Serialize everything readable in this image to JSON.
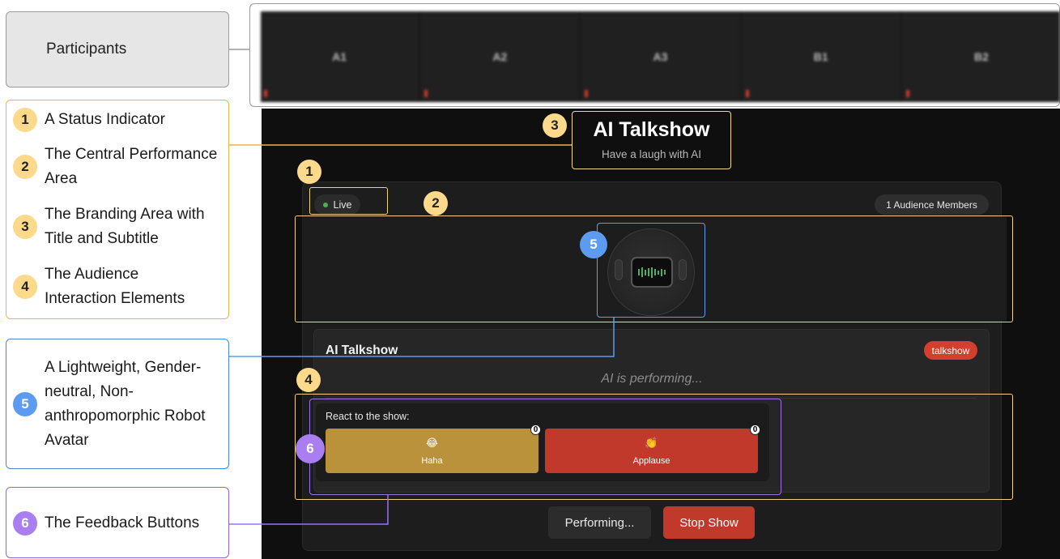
{
  "legend": {
    "participants_label": "Participants",
    "yellow_items": [
      {
        "num": "1",
        "text": "A Status Indicator"
      },
      {
        "num": "2",
        "text": "The Central Performance Area"
      },
      {
        "num": "3",
        "text": "The Branding Area with Title and Subtitle"
      },
      {
        "num": "4",
        "text": "The Audience Interaction Elements"
      }
    ],
    "blue_item": {
      "num": "5",
      "text": "A Lightweight, Gender-neutral, Non-anthropomorphic Robot Avatar"
    },
    "purple_item": {
      "num": "6",
      "text": "The Feedback Buttons"
    }
  },
  "participants": [
    "A1",
    "A2",
    "A3",
    "B1",
    "B2"
  ],
  "app": {
    "title": "AI Talkshow",
    "subtitle": "Have a laugh with AI",
    "status": "Live",
    "audience": "1 Audience Members",
    "show_title": "AI Talkshow",
    "show_tag": "talkshow",
    "performing_text": "AI is performing...",
    "react_label": "React to the show:",
    "reactions": [
      {
        "emoji": "😂",
        "label": "Haha",
        "count": "0"
      },
      {
        "emoji": "👏",
        "label": "Applause",
        "count": "0"
      }
    ],
    "performing_button": "Performing...",
    "stop_button": "Stop Show"
  },
  "markers": {
    "m1": "1",
    "m2": "2",
    "m3": "3",
    "m4": "4",
    "m5": "5",
    "m6": "6"
  },
  "colors": {
    "annotation_yellow": "#f0b24a",
    "annotation_blue": "#4a86d6",
    "annotation_purple": "#8f63e0",
    "live_dot": "#4caf50",
    "haha_button": "#b9923b",
    "applause_button": "#c0392b",
    "stop_button": "#c0392b"
  }
}
